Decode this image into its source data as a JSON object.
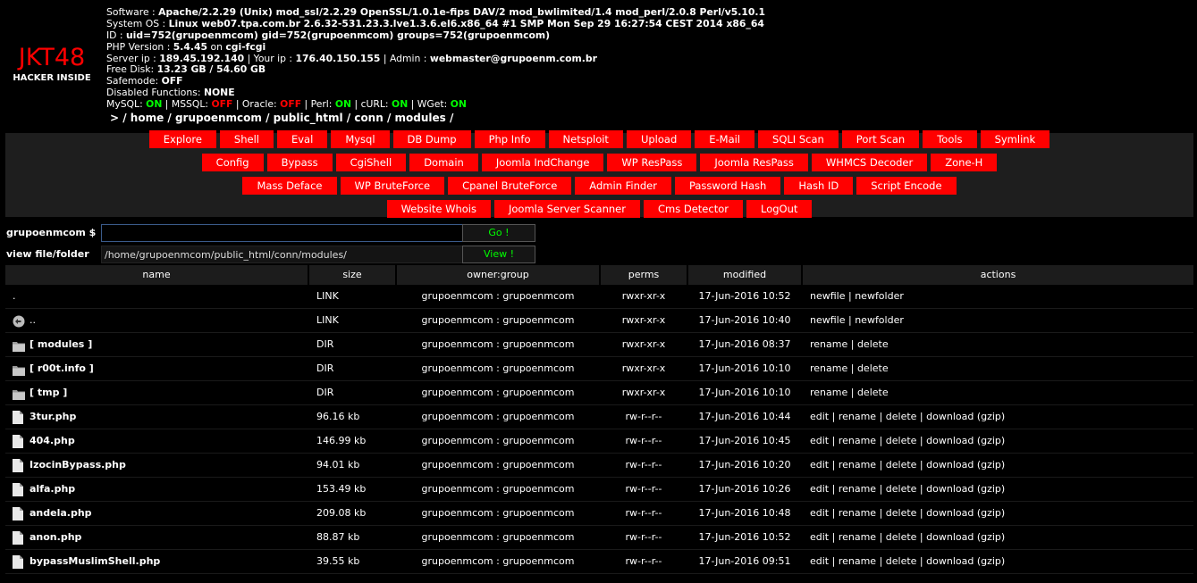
{
  "logo": {
    "title": "JKT48",
    "subtitle": "HACKER INSIDE"
  },
  "info": {
    "software_label": "Software : ",
    "software": "Apache/2.2.29 (Unix) mod_ssl/2.2.29 OpenSSL/1.0.1e-fips DAV/2 mod_bwlimited/1.4 mod_perl/2.0.8 Perl/v5.10.1",
    "os_label": "System OS : ",
    "os": "Linux web07.tpa.com.br 2.6.32-531.23.3.lve1.3.6.el6.x86_64 #1 SMP Mon Sep 29 16:27:54 CEST 2014 x86_64",
    "id_label": "ID : ",
    "id": "uid=752(grupoenmcom) gid=752(grupoenmcom) groups=752(grupoenmcom)",
    "php_label": "PHP Version : ",
    "php": "5.4.45",
    "php_on": " on ",
    "php_sapi": "cgi-fcgi",
    "server_ip_label": "Server ip : ",
    "server_ip": "189.45.192.140",
    "your_ip_label": " | Your ip : ",
    "your_ip": "176.40.150.155",
    "admin_label": " | Admin : ",
    "admin": "webmaster@grupoenm.com.br",
    "disk_label": "Free Disk: ",
    "disk_free": "13.23 GB",
    "disk_sep": " / ",
    "disk_total": "54.60 GB",
    "safemode_label": "Safemode: ",
    "safemode": "OFF",
    "disabled_label": "Disabled Functions: ",
    "disabled": "NONE",
    "mysql_label": "MySQL: ",
    "mysql": "ON",
    "mssql_label": " | MSSQL: ",
    "mssql": "OFF",
    "oracle_label": " | Oracle: ",
    "oracle": "OFF",
    "perl_label": " | Perl: ",
    "perl": "ON",
    "curl_label": " | cURL: ",
    "curl": "ON",
    "wget_label": " | WGet: ",
    "wget": "ON",
    "path": ">  / home / grupoenmcom / public_html / conn / modules /"
  },
  "menu": {
    "rows": [
      [
        "Explore",
        "Shell",
        "Eval",
        "Mysql",
        "DB Dump",
        "Php Info",
        "Netsploit",
        "Upload",
        "E-Mail",
        "SQLI Scan",
        "Port Scan",
        "Tools",
        "Symlink"
      ],
      [
        "Config",
        "Bypass",
        "CgiShell",
        "Domain",
        "Joomla IndChange",
        "WP ResPass",
        "Joomla ResPass",
        "WHMCS Decoder",
        "Zone-H"
      ],
      [
        "Mass Deface",
        "WP BruteForce",
        "Cpanel BruteForce",
        "Admin Finder",
        "Password Hash",
        "Hash ID",
        "Script Encode"
      ],
      [
        "Website Whois",
        "Joomla Server Scanner",
        "Cms Detector",
        "LogOut"
      ]
    ]
  },
  "form": {
    "cmd_label": "grupoenmcom $",
    "cmd_value": "",
    "cmd_button": "Go !",
    "view_label": "view file/folder",
    "view_value": "/home/grupoenmcom/public_html/conn/modules/",
    "view_button": "View !"
  },
  "table": {
    "headers": {
      "name": "name",
      "size": "size",
      "owner": "owner:group",
      "perms": "perms",
      "modified": "modified",
      "actions": "actions"
    },
    "rows": [
      {
        "icon": "none",
        "name": ".",
        "size": "LINK",
        "owner": "grupoenmcom : grupoenmcom",
        "perms": "rwxr-xr-x",
        "modified": "17-Jun-2016 10:52",
        "actions": [
          "newfile",
          "newfolder"
        ]
      },
      {
        "icon": "back",
        "name": "..",
        "size": "LINK",
        "owner": "grupoenmcom : grupoenmcom",
        "perms": "rwxr-xr-x",
        "modified": "17-Jun-2016 10:40",
        "actions": [
          "newfile",
          "newfolder"
        ]
      },
      {
        "icon": "folder",
        "name": "[ modules ]",
        "size": "DIR",
        "owner": "grupoenmcom : grupoenmcom",
        "perms": "rwxr-xr-x",
        "modified": "17-Jun-2016 08:37",
        "actions": [
          "rename",
          "delete"
        ]
      },
      {
        "icon": "folder",
        "name": "[ r00t.info ]",
        "size": "DIR",
        "owner": "grupoenmcom : grupoenmcom",
        "perms": "rwxr-xr-x",
        "modified": "17-Jun-2016 10:10",
        "actions": [
          "rename",
          "delete"
        ]
      },
      {
        "icon": "folder",
        "name": "[ tmp ]",
        "size": "DIR",
        "owner": "grupoenmcom : grupoenmcom",
        "perms": "rwxr-xr-x",
        "modified": "17-Jun-2016 10:10",
        "actions": [
          "rename",
          "delete"
        ]
      },
      {
        "icon": "file",
        "name": "3tur.php",
        "size": "96.16 kb",
        "owner": "grupoenmcom : grupoenmcom",
        "perms": "rw-r--r--",
        "modified": "17-Jun-2016 10:44",
        "actions": [
          "edit",
          "rename",
          "delete",
          "download (gzip)"
        ]
      },
      {
        "icon": "file",
        "name": "404.php",
        "size": "146.99 kb",
        "owner": "grupoenmcom : grupoenmcom",
        "perms": "rw-r--r--",
        "modified": "17-Jun-2016 10:45",
        "actions": [
          "edit",
          "rename",
          "delete",
          "download (gzip)"
        ]
      },
      {
        "icon": "file",
        "name": "IzocinBypass.php",
        "size": "94.01 kb",
        "owner": "grupoenmcom : grupoenmcom",
        "perms": "rw-r--r--",
        "modified": "17-Jun-2016 10:20",
        "actions": [
          "edit",
          "rename",
          "delete",
          "download (gzip)"
        ]
      },
      {
        "icon": "file",
        "name": "alfa.php",
        "size": "153.49 kb",
        "owner": "grupoenmcom : grupoenmcom",
        "perms": "rw-r--r--",
        "modified": "17-Jun-2016 10:26",
        "actions": [
          "edit",
          "rename",
          "delete",
          "download (gzip)"
        ]
      },
      {
        "icon": "file",
        "name": "andela.php",
        "size": "209.08 kb",
        "owner": "grupoenmcom : grupoenmcom",
        "perms": "rw-r--r--",
        "modified": "17-Jun-2016 10:48",
        "actions": [
          "edit",
          "rename",
          "delete",
          "download (gzip)"
        ]
      },
      {
        "icon": "file",
        "name": "anon.php",
        "size": "88.87 kb",
        "owner": "grupoenmcom : grupoenmcom",
        "perms": "rw-r--r--",
        "modified": "17-Jun-2016 10:52",
        "actions": [
          "edit",
          "rename",
          "delete",
          "download (gzip)"
        ]
      },
      {
        "icon": "file",
        "name": "bypassMuslimShell.php",
        "size": "39.55 kb",
        "owner": "grupoenmcom : grupoenmcom",
        "perms": "rw-r--r--",
        "modified": "17-Jun-2016 09:51",
        "actions": [
          "edit",
          "rename",
          "delete",
          "download (gzip)"
        ]
      }
    ]
  },
  "colors": {
    "accent": "#ff0000",
    "on": "#00ff00",
    "off": "#ff0000",
    "menu_bg": "#1e1e1e",
    "header_bg": "#1c1c1c"
  }
}
